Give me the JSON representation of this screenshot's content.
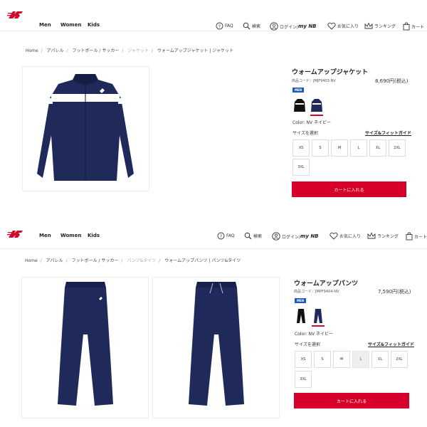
{
  "brand": {
    "logo_name": "new-balance-logo",
    "accent": "#cf0a2c"
  },
  "nav": {
    "men": "Men",
    "women": "Women",
    "kids": "Kids"
  },
  "utility": {
    "faq": "FAQ",
    "search": "検索",
    "login": "ログイン/",
    "mynb": "my NB",
    "favorites": "お気に入り",
    "ranking": "ランキング",
    "cart": "カート"
  },
  "panel1": {
    "breadcrumb": [
      "Home",
      "アパレル",
      "フットボール / サッカー",
      "ジャケット",
      "ウォームアップジャケット | ジャケット"
    ],
    "product": {
      "title": "ウォームアップジャケット",
      "code": "商品コード：JMJF9403-NV",
      "price": "8,690円(税込)",
      "badge": "MEN",
      "color": "Color: NV ネイビー"
    },
    "size_label": "サイズを選択",
    "size_guide": "サイズ&フィットガイド",
    "sizes": [
      "XS",
      "S",
      "M",
      "L",
      "XL",
      "2XL",
      "3XL"
    ],
    "cart_button": "カートに入れる"
  },
  "panel2": {
    "breadcrumb": [
      "Home",
      "アパレル",
      "フットボール / サッカー",
      "パンツ&タイツ",
      "ウォームアップパンツ | パンツ&タイツ"
    ],
    "product": {
      "title": "ウォームアップパンツ",
      "code": "商品コード：JMPF9404-NV",
      "price": "7,590円(税込)",
      "badge": "MEN",
      "color": "Color: NV ネイビー"
    },
    "size_label": "サイズを選択",
    "size_guide": "サイズ&フィットガイド",
    "sizes": [
      "XS",
      "S",
      "M",
      "L",
      "XL",
      "2XL",
      "3XL"
    ],
    "cart_button": "カートに入れる"
  }
}
